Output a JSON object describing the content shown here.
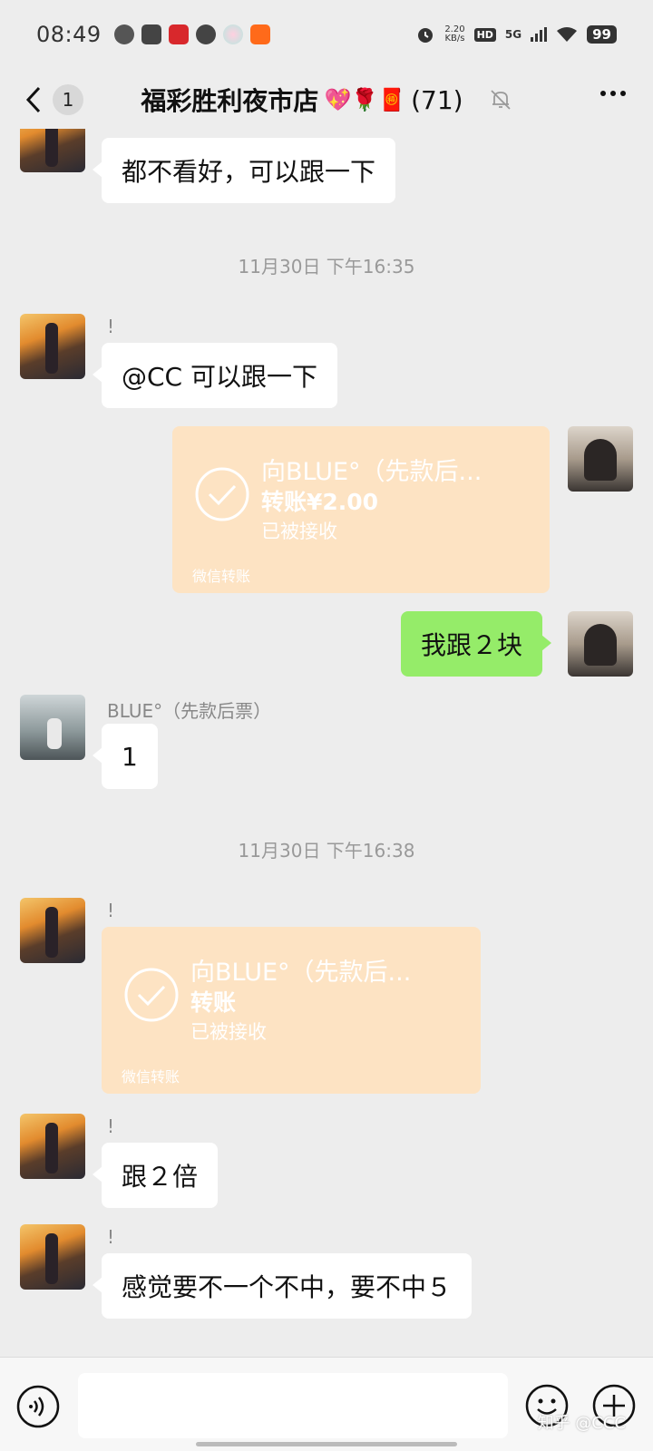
{
  "status_bar": {
    "time": "08:49",
    "net_rate_top": "2.20",
    "net_rate_unit": "KB/s",
    "hd": "HD",
    "signal": "5G",
    "battery": "99"
  },
  "header": {
    "back_badge": "1",
    "title": "福彩胜利夜市店",
    "title_emojis": "💖🌹🧧",
    "member_count": "(71)"
  },
  "messages": {
    "m1_text": "都不看好，可以跟一下",
    "ts1": "11月30日 下午16:35",
    "m2_sender": "!",
    "m2_text": "@CC  可以跟一下",
    "t1": {
      "to": "向BLUE°（先款后...",
      "amount": "转账¥2.00",
      "status": "已被接收",
      "footer": "微信转账"
    },
    "m3_text": "我跟２块",
    "m4_sender": "BLUE°（先款后票）",
    "m4_text": "1",
    "ts2": "11月30日 下午16:38",
    "m5_sender": "!",
    "t2": {
      "to": "向BLUE°（先款后...",
      "amount": "转账",
      "status": "已被接收",
      "footer": "微信转账"
    },
    "m6_sender": "!",
    "m6_text": "跟２倍",
    "m7_sender": "!",
    "m7_text": "感觉要不一个不中，要不中５"
  },
  "input": {
    "watermark": "知乎 @CCC"
  },
  "colors": {
    "chat_bg": "#ededed",
    "green_bubble": "#95ec69",
    "transfer_bg": "#fde3c3"
  }
}
